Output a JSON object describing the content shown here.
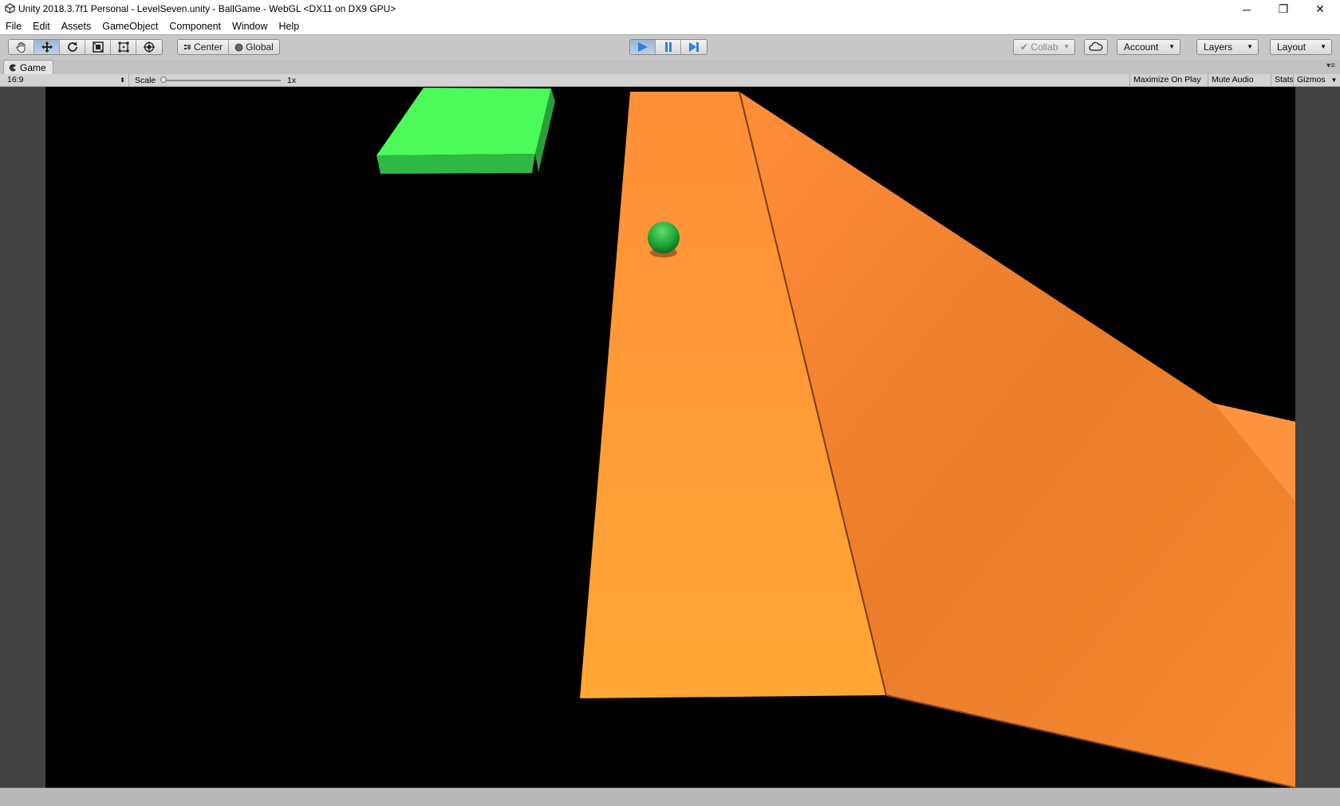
{
  "window": {
    "title": "Unity 2018.3.7f1 Personal - LevelSeven.unity - BallGame - WebGL <DX11 on DX9 GPU>",
    "minimize_glyph": "─",
    "restore_glyph": "❐",
    "close_glyph": "✕"
  },
  "menu": {
    "items": [
      "File",
      "Edit",
      "Assets",
      "GameObject",
      "Component",
      "Window",
      "Help"
    ]
  },
  "toolbar": {
    "tools": [
      "hand-tool-icon",
      "move-tool-icon",
      "rotate-tool-icon",
      "scale-tool-icon",
      "rect-tool-icon",
      "transform-tool-icon"
    ],
    "active_tool": "move-tool-icon",
    "pivot_label": "Center",
    "space_label": "Global",
    "play_active": true,
    "collab_label": "Collab",
    "account_label": "Account",
    "layers_label": "Layers",
    "layout_label": "Layout",
    "accent_color": "#2f7ee6"
  },
  "game_panel": {
    "tab_label": "Game",
    "aspect": "16:9",
    "scale_label": "Scale",
    "scale_value": "1x",
    "maximize_label": "Maximize On Play",
    "mute_label": "Mute Audio",
    "stats_label": "Stats",
    "gizmos_label": "Gizmos"
  },
  "scene": {
    "background_color": "#000000",
    "platform_color": "#ff9130",
    "block_color": "#4cfa5a",
    "ball_color": "#22a83a"
  }
}
